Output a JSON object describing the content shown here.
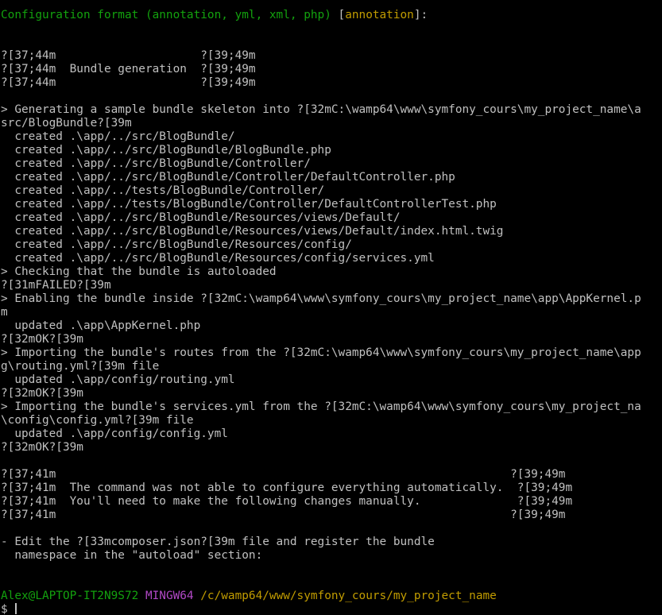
{
  "colors": {
    "background": "#000000",
    "text": "#c0c0c0",
    "green": "#13a10e",
    "yellow": "#c19c00",
    "magenta": "#b148c6"
  },
  "lines": [
    {
      "row": 0,
      "segs": [
        {
          "t": "Configuration format (annotation, yml, xml, php) ",
          "c": "green"
        },
        {
          "t": "[",
          "c": "text"
        },
        {
          "t": "annotation",
          "c": "yellow"
        },
        {
          "t": "]:",
          "c": "text"
        }
      ]
    },
    {
      "row": 3,
      "segs": [
        {
          "t": "?[37;44m                     ?[39;49m",
          "c": "text"
        }
      ]
    },
    {
      "row": 4,
      "segs": [
        {
          "t": "?[37;44m  Bundle generation  ?[39;49m",
          "c": "text"
        }
      ]
    },
    {
      "row": 5,
      "segs": [
        {
          "t": "?[37;44m                     ?[39;49m",
          "c": "text"
        }
      ]
    },
    {
      "row": 7,
      "segs": [
        {
          "t": "> Generating a sample bundle skeleton into ?[32mC:\\wamp64\\www\\symfony_cours\\my_project_name\\a",
          "c": "text"
        }
      ]
    },
    {
      "row": 8,
      "segs": [
        {
          "t": "src/BlogBundle?[39m",
          "c": "text"
        }
      ]
    },
    {
      "row": 9,
      "segs": [
        {
          "t": "  created .\\app/../src/BlogBundle/",
          "c": "text"
        }
      ]
    },
    {
      "row": 10,
      "segs": [
        {
          "t": "  created .\\app/../src/BlogBundle/BlogBundle.php",
          "c": "text"
        }
      ]
    },
    {
      "row": 11,
      "segs": [
        {
          "t": "  created .\\app/../src/BlogBundle/Controller/",
          "c": "text"
        }
      ]
    },
    {
      "row": 12,
      "segs": [
        {
          "t": "  created .\\app/../src/BlogBundle/Controller/DefaultController.php",
          "c": "text"
        }
      ]
    },
    {
      "row": 13,
      "segs": [
        {
          "t": "  created .\\app/../tests/BlogBundle/Controller/",
          "c": "text"
        }
      ]
    },
    {
      "row": 14,
      "segs": [
        {
          "t": "  created .\\app/../tests/BlogBundle/Controller/DefaultControllerTest.php",
          "c": "text"
        }
      ]
    },
    {
      "row": 15,
      "segs": [
        {
          "t": "  created .\\app/../src/BlogBundle/Resources/views/Default/",
          "c": "text"
        }
      ]
    },
    {
      "row": 16,
      "segs": [
        {
          "t": "  created .\\app/../src/BlogBundle/Resources/views/Default/index.html.twig",
          "c": "text"
        }
      ]
    },
    {
      "row": 17,
      "segs": [
        {
          "t": "  created .\\app/../src/BlogBundle/Resources/config/",
          "c": "text"
        }
      ]
    },
    {
      "row": 18,
      "segs": [
        {
          "t": "  created .\\app/../src/BlogBundle/Resources/config/services.yml",
          "c": "text"
        }
      ]
    },
    {
      "row": 19,
      "segs": [
        {
          "t": "> Checking that the bundle is autoloaded",
          "c": "text"
        }
      ]
    },
    {
      "row": 20,
      "segs": [
        {
          "t": "?[31mFAILED?[39m",
          "c": "text"
        }
      ]
    },
    {
      "row": 21,
      "segs": [
        {
          "t": "> Enabling the bundle inside ?[32mC:\\wamp64\\www\\symfony_cours\\my_project_name\\app\\AppKernel.p",
          "c": "text"
        }
      ]
    },
    {
      "row": 22,
      "segs": [
        {
          "t": "m",
          "c": "text"
        }
      ]
    },
    {
      "row": 23,
      "segs": [
        {
          "t": "  updated .\\app\\AppKernel.php",
          "c": "text"
        }
      ]
    },
    {
      "row": 24,
      "segs": [
        {
          "t": "?[32mOK?[39m",
          "c": "text"
        }
      ]
    },
    {
      "row": 25,
      "segs": [
        {
          "t": "> Importing the bundle's routes from the ?[32mC:\\wamp64\\www\\symfony_cours\\my_project_name\\app",
          "c": "text"
        }
      ]
    },
    {
      "row": 26,
      "segs": [
        {
          "t": "g\\routing.yml?[39m file",
          "c": "text"
        }
      ]
    },
    {
      "row": 27,
      "segs": [
        {
          "t": "  updated .\\app/config/routing.yml",
          "c": "text"
        }
      ]
    },
    {
      "row": 28,
      "segs": [
        {
          "t": "?[32mOK?[39m",
          "c": "text"
        }
      ]
    },
    {
      "row": 29,
      "segs": [
        {
          "t": "> Importing the bundle's services.yml from the ?[32mC:\\wamp64\\www\\symfony_cours\\my_project_na",
          "c": "text"
        }
      ]
    },
    {
      "row": 30,
      "segs": [
        {
          "t": "\\config\\config.yml?[39m file",
          "c": "text"
        }
      ]
    },
    {
      "row": 31,
      "segs": [
        {
          "t": "  updated .\\app/config/config.yml",
          "c": "text"
        }
      ]
    },
    {
      "row": 32,
      "segs": [
        {
          "t": "?[32mOK?[39m",
          "c": "text"
        }
      ]
    },
    {
      "row": 34,
      "segs": [
        {
          "t": "?[37;41m                                                                  ?[39;49m",
          "c": "text"
        }
      ]
    },
    {
      "row": 35,
      "segs": [
        {
          "t": "?[37;41m  The command was not able to configure everything automatically.  ?[39;49m",
          "c": "text"
        }
      ]
    },
    {
      "row": 36,
      "segs": [
        {
          "t": "?[37;41m  You'll need to make the following changes manually.              ?[39;49m",
          "c": "text"
        }
      ]
    },
    {
      "row": 37,
      "segs": [
        {
          "t": "?[37;41m                                                                  ?[39;49m",
          "c": "text"
        }
      ]
    },
    {
      "row": 39,
      "segs": [
        {
          "t": "- Edit the ?[33mcomposer.json?[39m file and register the bundle",
          "c": "text"
        }
      ]
    },
    {
      "row": 40,
      "segs": [
        {
          "t": "  namespace in the \"autoload\" section:",
          "c": "text"
        }
      ]
    },
    {
      "row": 43,
      "segs": [
        {
          "t": "Alex@LAPTOP-IT2N9S72 ",
          "c": "green"
        },
        {
          "t": "MINGW64 ",
          "c": "magenta"
        },
        {
          "t": "/c/wamp64/www/symfony_cours/my_project_name",
          "c": "yellow"
        }
      ]
    },
    {
      "row": 44,
      "segs": [
        {
          "t": "$ ",
          "c": "text"
        }
      ],
      "cursor": true
    }
  ]
}
